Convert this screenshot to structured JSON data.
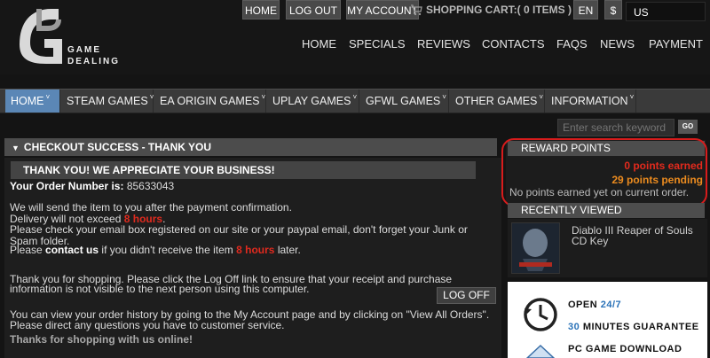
{
  "brand": {
    "line1": "GAME",
    "line2": "DEALING"
  },
  "top_buttons": {
    "home": "HOME",
    "logout": "LOG OUT",
    "account": "MY ACCOUNT"
  },
  "cart": {
    "label": "SHOPPING CART:( 0 ITEMS )"
  },
  "lang": "EN",
  "currency_symbol": "$",
  "currency_select": "US",
  "top_nav": [
    "HOME",
    "SPECIALS",
    "REVIEWS",
    "CONTACTS",
    "FAQS",
    "NEWS",
    "PAYMENT"
  ],
  "menu": [
    {
      "label": "HOME",
      "active": true
    },
    {
      "label": "STEAM GAMES"
    },
    {
      "label": "EA ORIGIN GAMES"
    },
    {
      "label": "UPLAY GAMES"
    },
    {
      "label": "GFWL GAMES"
    },
    {
      "label": "OTHER GAMES"
    },
    {
      "label": "INFORMATION"
    }
  ],
  "menu_caret": "˅",
  "search": {
    "placeholder": "Enter search keyword",
    "button": "GO"
  },
  "checkout": {
    "title": "CHECKOUT SUCCESS - THANK YOU",
    "subtitle": "THANK YOU! WE APPRECIATE YOUR BUSINESS!",
    "order_label": "Your Order Number is:",
    "order_number": "85633043",
    "line1": "We will send the item to you after the payment confirmation.",
    "line2_pre": "Delivery will not exceed",
    "line2_red": "8 hours",
    "line2_post": ".",
    "line3": "Please check your email box registered on our site or your paypal email, don't forget your Junk or",
    "line4": "Spam folder.",
    "line5_pre": "Please",
    "line5_bold": "contact us",
    "line5_mid": "if you didn't receive the item",
    "line5_red": "8 hours",
    "line5_post": "later.",
    "para2_1": "Thank you for shopping. Please click the Log Off link to ensure that your receipt and purchase",
    "para2_2": "information is not visible to the next person using this computer.",
    "logoff": "LOG OFF",
    "para3_1": "You can view your order history by going to the My Account page and by clicking on \"View All Orders\".",
    "para3_2": "Please direct any questions you have to customer service.",
    "thanks": "Thanks for shopping with us online!"
  },
  "reward_points": {
    "title": "REWARD POINTS",
    "earned": "0 points earned",
    "pending": "29 points pending",
    "note": "No points earned yet on current order."
  },
  "recently_viewed": {
    "title": "RECENTLY VIEWED",
    "item_line1": "Diablo III Reaper of Souls",
    "item_line2": "CD Key"
  },
  "services": {
    "open_label": "OPEN",
    "open_hours": "24/7",
    "minutes_num": "30",
    "minutes_text": "MINUTES GUARANTEE",
    "pc_download": "PC GAME DOWNLOAD"
  },
  "colors": {
    "accent_blue": "#5b87b6",
    "highlight_red": "#e02a1e",
    "pending_orange": "#eb8b1f",
    "service_blue": "#2a72b8"
  }
}
